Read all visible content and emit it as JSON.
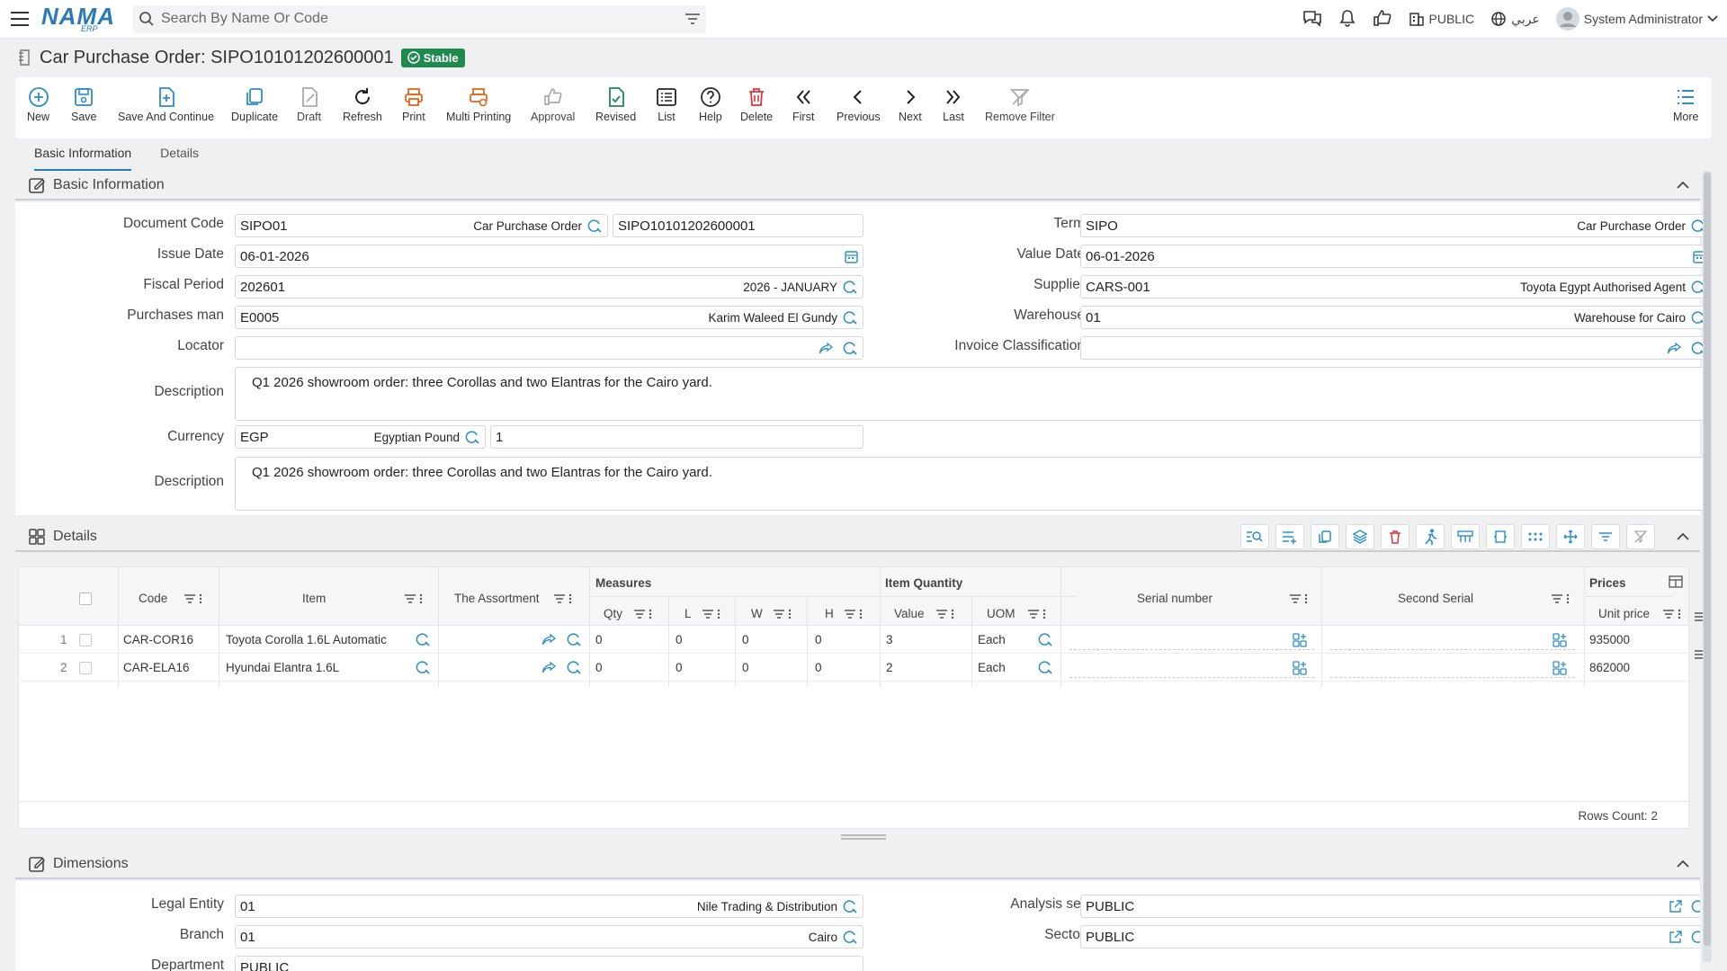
{
  "topbar": {
    "logo_main": "NAMA",
    "logo_sub": "ERP",
    "search_placeholder": "Search By Name Or Code",
    "company": "PUBLIC",
    "language": "عربي",
    "user": "System Administrator"
  },
  "page": {
    "title": "Car Purchase Order: SIPO10101202600001",
    "status": "Stable"
  },
  "toolbar": [
    {
      "label": "New",
      "icon": "plus-circle-icon"
    },
    {
      "label": "Save",
      "icon": "save-icon"
    },
    {
      "label": "Save And Continue",
      "icon": "save-continue-icon"
    },
    {
      "label": "Duplicate",
      "icon": "duplicate-icon"
    },
    {
      "label": "Draft",
      "icon": "draft-icon"
    },
    {
      "label": "Refresh",
      "icon": "refresh-icon"
    },
    {
      "label": "Print",
      "icon": "print-icon"
    },
    {
      "label": "Multi Printing",
      "icon": "multi-print-icon"
    },
    {
      "label": "Approval",
      "icon": "thumbs-up-icon"
    },
    {
      "label": "Revised",
      "icon": "revised-icon"
    },
    {
      "label": "List",
      "icon": "list-icon"
    },
    {
      "label": "Help",
      "icon": "help-icon"
    },
    {
      "label": "Delete",
      "icon": "trash-icon"
    },
    {
      "label": "First",
      "icon": "first-icon"
    },
    {
      "label": "Previous",
      "icon": "previous-icon"
    },
    {
      "label": "Next",
      "icon": "next-icon"
    },
    {
      "label": "Last",
      "icon": "last-icon"
    },
    {
      "label": "Remove Filter",
      "icon": "remove-filter-icon"
    },
    {
      "label": "More",
      "icon": "more-icon"
    }
  ],
  "tabs": [
    "Basic Information",
    "Details"
  ],
  "basic": {
    "header": "Basic Information",
    "document_code_label": "Document Code",
    "document_code": "SIPO01",
    "document_code_name": "Car Purchase Order",
    "document_number": "SIPO10101202600001",
    "term_label": "Term",
    "term": "SIPO",
    "term_name": "Car Purchase Order",
    "issue_date_label": "Issue Date",
    "issue_date": "06-01-2026",
    "value_date_label": "Value Date",
    "value_date": "06-01-2026",
    "fiscal_period_label": "Fiscal Period",
    "fiscal_period": "202601",
    "fiscal_period_name": "2026 - JANUARY",
    "supplier_label": "Supplier",
    "supplier": "CARS-001",
    "supplier_name": "Toyota Egypt Authorised Agent",
    "purchases_man_label": "Purchases man",
    "purchases_man": "E0005",
    "purchases_man_name": "Karim Waleed El Gundy",
    "warehouse_label": "Warehouse",
    "warehouse": "01",
    "warehouse_name": "Warehouse for Cairo",
    "locator_label": "Locator",
    "invoice_class_label": "Invoice Classification",
    "description_label": "Description",
    "description": "Q1 2026 showroom order: three Corollas and two Elantras for the Cairo yard.",
    "currency_label": "Currency",
    "currency": "EGP",
    "currency_name": "Egyptian Pound",
    "rate": "1",
    "description2_label": "Description",
    "description2": "Q1 2026 showroom order: three Corollas and two Elantras for the Cairo yard."
  },
  "details": {
    "header": "Details",
    "group_measures": "Measures",
    "group_item_qty": "Item Quantity",
    "group_prices": "Prices",
    "columns": {
      "code": "Code",
      "item": "Item",
      "assortment": "The Assortment",
      "qty": "Qty",
      "l": "L",
      "w": "W",
      "h": "H",
      "value": "Value",
      "uom": "UOM",
      "serial": "Serial number",
      "second_serial": "Second Serial",
      "unit_price": "Unit price"
    },
    "rows": [
      {
        "n": "1",
        "code": "CAR-COR16",
        "item": "Toyota Corolla 1.6L Automatic",
        "qty": "0",
        "l": "0",
        "w": "0",
        "h": "0",
        "value": "3",
        "uom": "Each",
        "unit_price": "935000"
      },
      {
        "n": "2",
        "code": "CAR-ELA16",
        "item": "Hyundai Elantra 1.6L",
        "qty": "0",
        "l": "0",
        "w": "0",
        "h": "0",
        "value": "2",
        "uom": "Each",
        "unit_price": "862000"
      }
    ],
    "rows_count": "Rows Count: 2"
  },
  "dimensions": {
    "header": "Dimensions",
    "legal_entity_label": "Legal Entity",
    "legal_entity": "01",
    "legal_entity_name": "Nile Trading & Distribution",
    "analysis_set_label": "Analysis set",
    "analysis_set": "PUBLIC",
    "branch_label": "Branch",
    "branch": "01",
    "branch_name": "Cairo",
    "sector_label": "Sector",
    "sector": "PUBLIC",
    "department_label": "Department",
    "department": "PUBLIC"
  },
  "colors": {
    "accent": "#2a7ab8",
    "status": "#1e8a4e",
    "delete": "#d9363e",
    "print": "#e0661b"
  }
}
